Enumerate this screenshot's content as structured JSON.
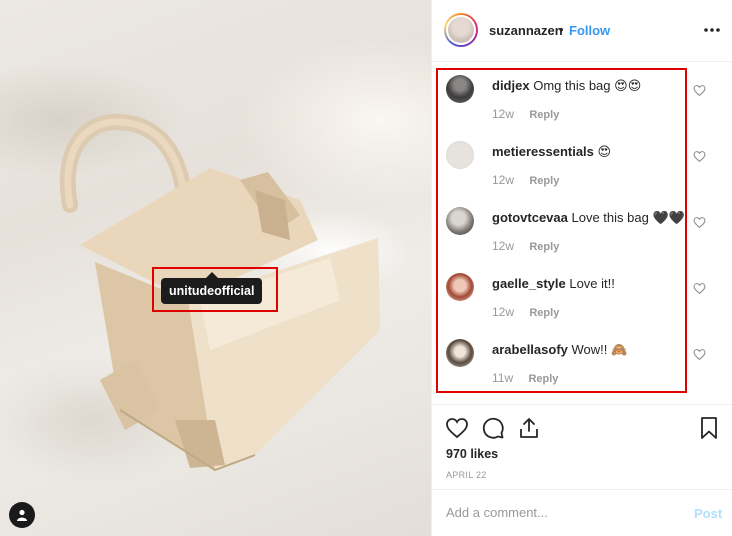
{
  "post": {
    "username": "suzannazen",
    "separator": "•",
    "follow_label": "Follow",
    "photo_tag": "unitudeofficial"
  },
  "comments": [
    {
      "username": "didjex",
      "text": "Omg this bag",
      "emoji": "😍😍",
      "time": "12w",
      "reply_label": "Reply"
    },
    {
      "username": "metieressentials",
      "text": "",
      "emoji": "😍",
      "time": "12w",
      "reply_label": "Reply"
    },
    {
      "username": "gotovtcevaa",
      "text": "Love this bag",
      "emoji": "🖤🖤",
      "time": "12w",
      "reply_label": "Reply"
    },
    {
      "username": "gaelle_style",
      "text": "Love it!!",
      "emoji": "",
      "time": "12w",
      "reply_label": "Reply"
    },
    {
      "username": "arabellasofy",
      "text": "Wow!!",
      "emoji": "🙈",
      "time": "11w",
      "reply_label": "Reply"
    }
  ],
  "actions": {
    "likes": "970 likes",
    "date": "APRIL 22"
  },
  "add_comment": {
    "placeholder": "Add a comment...",
    "post_label": "Post"
  },
  "colors": {
    "follow": "#3897f0",
    "post_disabled": "#b2dffc",
    "highlight": "#e00000"
  },
  "icons": [
    "more-icon",
    "heart-icon",
    "comment-icon",
    "share-icon",
    "bookmark-icon",
    "user-tag-icon"
  ]
}
